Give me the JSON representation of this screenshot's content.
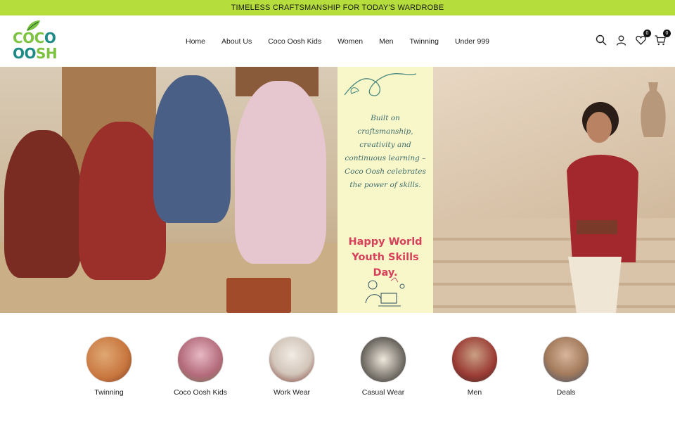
{
  "announcement": "TIMELESS CRAFTSMANSHIP FOR TODAY'S WARDROBE",
  "logo": {
    "line1_part1": "COC",
    "line1_part2": "O",
    "line2_part1": "OO",
    "line2_part2": "SH"
  },
  "nav": [
    "Home",
    "About Us",
    "Coco Oosh Kids",
    "Women",
    "Men",
    "Twinning",
    "Under 999"
  ],
  "icons": {
    "search": "search-icon",
    "account": "user-icon",
    "wishlist": "heart-icon",
    "cart": "cart-icon"
  },
  "badges": {
    "wishlist": "0",
    "cart": "0"
  },
  "hero": {
    "quote_lines": [
      "Built on",
      "craftsmanship,",
      "creativity and",
      "continuous learning –",
      "Coco Oosh celebrates",
      "the power of skills."
    ],
    "headline_lines": [
      "Happy World",
      "Youth Skills Day."
    ],
    "slides_total": 3,
    "active_slide": 1
  },
  "categories": [
    {
      "label": "Twinning",
      "color": "#c8763e"
    },
    {
      "label": "Coco Oosh Kids",
      "color": "#b36a7a"
    },
    {
      "label": "Work Wear",
      "color": "#d3c6ba"
    },
    {
      "label": "Casual Wear",
      "color": "#6f6a63"
    },
    {
      "label": "Men",
      "color": "#9a3b34"
    },
    {
      "label": "Deals",
      "color": "#a47b5c"
    }
  ],
  "colors": {
    "announcement_bg": "#b5dd3c",
    "logo_green": "#7ec242",
    "logo_teal": "#1f8b87",
    "headline_pink": "#d7405a",
    "quote_teal": "#3f6e6d",
    "panel_cream": "#f8f7c9"
  }
}
